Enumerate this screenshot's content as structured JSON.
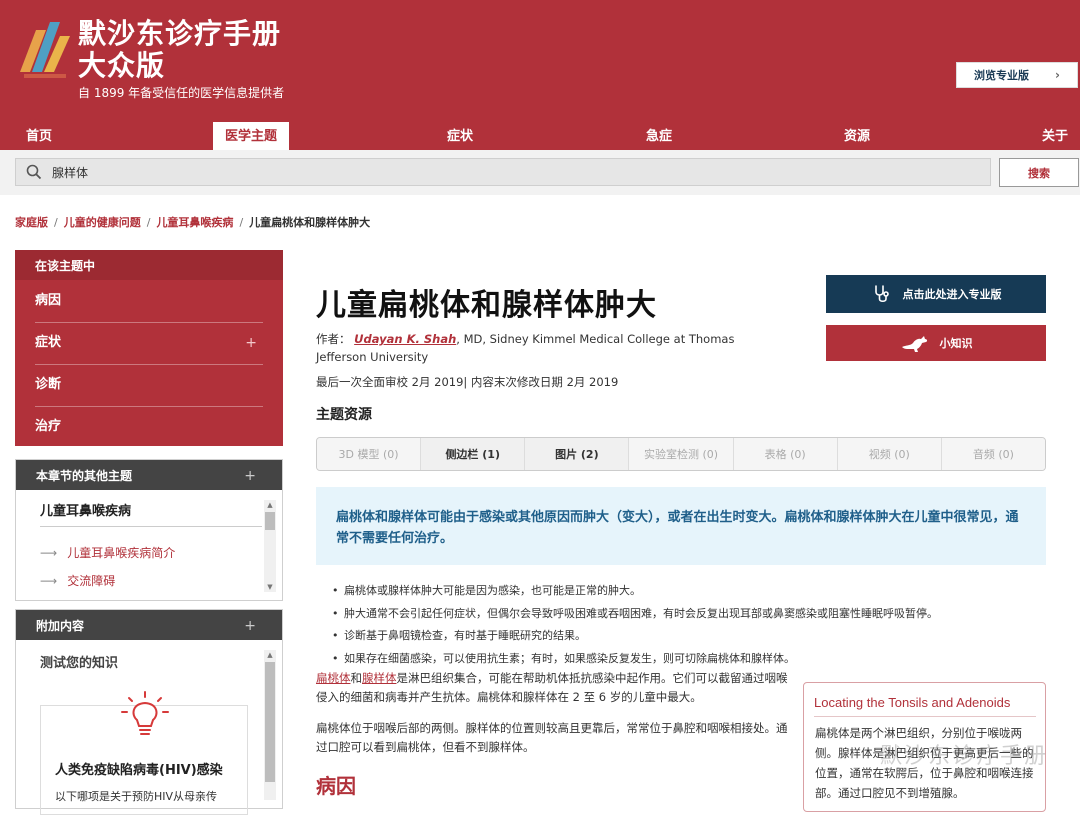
{
  "header": {
    "brand_title": "默沙东诊疗手册",
    "brand_subtitle": "大众版",
    "tagline": "自 1899 年备受信任的医学信息提供者",
    "pro_button": "浏览专业版",
    "colors": {
      "brand_red": "#b1313a",
      "pro_navy": "#163a55"
    }
  },
  "nav": {
    "items": [
      "首页",
      "医学主题",
      "症状",
      "急症",
      "资源",
      "关于"
    ],
    "active": "医学主题"
  },
  "search": {
    "value": "腺样体",
    "button": "搜索",
    "icon": "search-icon"
  },
  "breadcrumb": {
    "links": [
      "家庭版",
      "儿童的健康问题",
      "儿童耳鼻喉疾病"
    ],
    "separator": "/",
    "current": "儿童扁桃体和腺样体肿大"
  },
  "sidebar": {
    "topic_panel": {
      "header": "在该主题中",
      "items": [
        {
          "label": "病因",
          "expandable": false
        },
        {
          "label": "症状",
          "expandable": true
        },
        {
          "label": "诊断",
          "expandable": false
        },
        {
          "label": "治疗",
          "expandable": false
        }
      ]
    },
    "other_topics": {
      "header": "本章节的其他主题",
      "section_title": "儿童耳鼻喉疾病",
      "links": [
        "儿童耳鼻喉疾病简介",
        "交流障碍"
      ]
    },
    "extra_content": {
      "header": "附加内容",
      "quiz_title": "测试您的知识",
      "card_title": "人类免疫缺陷病毒(HIV)感染",
      "card_text": "以下哪项是关于预防HIV从母亲传"
    }
  },
  "main": {
    "title": "儿童扁桃体和腺样体肿大",
    "author_prefix": "作者：",
    "author_name": "Udayan K. Shah",
    "author_suffix": ", MD, Sidney Kimmel Medical College at Thomas Jefferson University",
    "review_line": "最后一次全面审校 2月 2019| 内容末次修改日期 2月 2019",
    "resources_heading": "主题资源",
    "resource_tabs": [
      {
        "label": "3D 模型 (0)",
        "enabled": false
      },
      {
        "label": "侧边栏 (1)",
        "enabled": true
      },
      {
        "label": "图片 (2)",
        "enabled": true
      },
      {
        "label": "实验室检测 (0)",
        "enabled": false
      },
      {
        "label": "表格 (0)",
        "enabled": false
      },
      {
        "label": "视频 (0)",
        "enabled": false
      },
      {
        "label": "音频 (0)",
        "enabled": false
      }
    ],
    "summary": "扁桃体和腺样体可能由于感染或其他原因而肿大（变大），或者在出生时变大。扁桃体和腺样体肿大在儿童中很常见，通常不需要任何治疗。",
    "bullets": [
      "扁桃体或腺样体肿大可能是因为感染，也可能是正常的肿大。",
      "肿大通常不会引起任何症状，但偶尔会导致呼吸困难或吞咽困难，有时会反复出现耳部或鼻窦感染或阻塞性睡眠呼吸暂停。",
      "诊断基于鼻咽镜检查，有时基于睡眠研究的结果。",
      "如果存在细菌感染，可以使用抗生素；有时，如果感染反复发生，则可切除扁桃体和腺样体。"
    ],
    "para1_link1": "扁桃体",
    "para1_mid": "和",
    "para1_link2": "腺样体",
    "para1_rest": "是淋巴组织集合，可能在帮助机体抵抗感染中起作用。它们可以截留通过咽喉侵入的细菌和病毒并产生抗体。扁桃体和腺样体在 2 至 6 岁的儿童中最大。",
    "para2": "扁桃体位于咽喉后部的两侧。腺样体的位置则较高且更靠后，常常位于鼻腔和咽喉相接处。通过口腔可以看到扁桃体，但看不到腺样体。",
    "cause_heading": "病因",
    "side_buttons": {
      "pro_entry": "点击此处进入专业版",
      "fact": "小知识"
    },
    "illustration": {
      "title": "Locating the Tonsils and Adenoids",
      "text": "扁桃体是两个淋巴组织，分别位于喉咙两侧。腺样体是淋巴组织位于更高更后一些的位置，通常在软腭后，位于鼻腔和咽喉连接部。通过口腔见不到增殖腺。"
    },
    "watermark": "默沙东诊疗手册"
  }
}
